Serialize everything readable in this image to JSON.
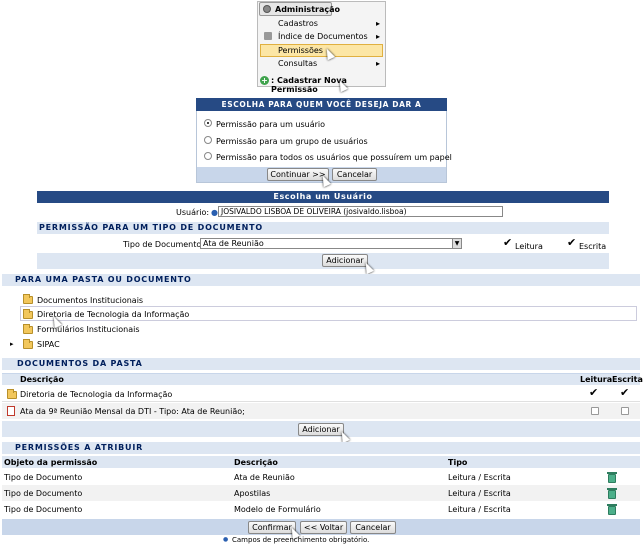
{
  "menu": {
    "title": "Administração",
    "items": [
      "Cadastros",
      "Índice de Documentos",
      "Permissões",
      "Consultas"
    ],
    "footer": ": Cadastrar Nova Permissão"
  },
  "choose": {
    "title": "Escolha para quem você deseja dar a permissão",
    "options": [
      "Permissão para um usuário",
      "Permissão para um grupo de usuários",
      "Permissão para todos os usuários que possuírem um papel"
    ],
    "continue": "Continuar >>",
    "cancel": "Cancelar"
  },
  "user": {
    "title": "Escolha um Usuário",
    "label": "Usuário:",
    "value": "JOSIVALDO LISBOA DE OLIVEIRA (josivaldo.lisboa)"
  },
  "type_section": {
    "title": "Permissão para um tipo de documento",
    "doc_type_label": "Tipo de Documento:",
    "doc_type_value": "Ata de Reunião",
    "leitura": "Leitura",
    "escrita": "Escrita",
    "add": "Adicionar"
  },
  "folder_section": {
    "title": "Para uma pasta ou documento",
    "folders": [
      "Documentos Institucionais",
      "Diretoria de Tecnologia da Informação",
      "Formulários Institucionais",
      "SIPAC"
    ]
  },
  "docs": {
    "title": "Documentos da Pasta",
    "headers": [
      "Descrição",
      "Leitura",
      "Escrita"
    ],
    "rows": [
      "Diretoria de Tecnologia da Informação",
      "Ata da 9ª Reunião Mensal da DTI - Tipo: Ata de Reunião;"
    ],
    "add": "Adicionar"
  },
  "perms": {
    "title": "Permissões a atribuir",
    "headers": [
      "Objeto da permissão",
      "Descrição",
      "Tipo"
    ],
    "rows": [
      {
        "obj": "Tipo de Documento",
        "desc": "Ata de Reunião",
        "tipo": "Leitura / Escrita"
      },
      {
        "obj": "Tipo de Documento",
        "desc": "Apostilas",
        "tipo": "Leitura / Escrita"
      },
      {
        "obj": "Tipo de Documento",
        "desc": "Modelo de Formulário",
        "tipo": "Leitura / Escrita"
      }
    ]
  },
  "footer": {
    "confirm": "Confirmar",
    "back": "<< Voltar",
    "cancel": "Cancelar",
    "note": "Campos de preenchimento obrigatório."
  }
}
